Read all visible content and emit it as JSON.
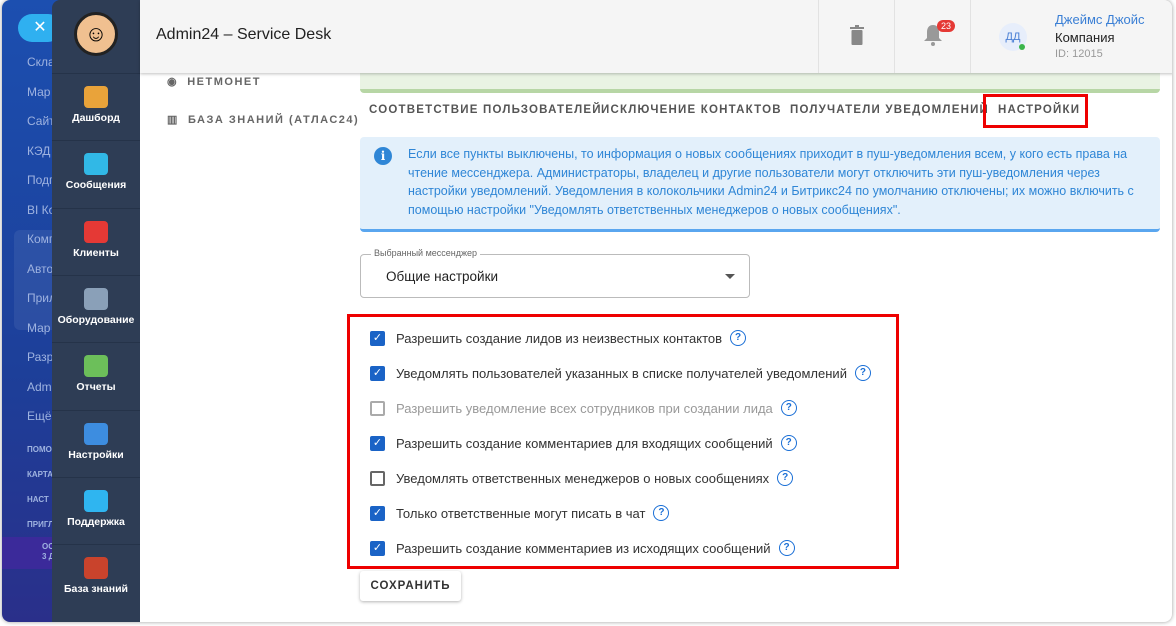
{
  "bitrix_menu": {
    "close": "✕",
    "items": [
      "Скла",
      "Мар",
      "Сайт",
      "КЭД",
      "Подг",
      "BI Ко",
      "Комп",
      "Авто",
      "Прил",
      "Мар",
      "Разр",
      "Adm",
      "Ещё"
    ],
    "small": [
      "ПОМО",
      "КАРТА",
      "НАСТ",
      "ПРИГЛ"
    ],
    "premium": [
      "ОС",
      "3 Д"
    ]
  },
  "app_nav": [
    {
      "label": "Дашборд",
      "icon": "dashboard-icon",
      "color": "#e9a33a"
    },
    {
      "label": "Сообщения",
      "icon": "messages-icon",
      "color": "#31b8e6"
    },
    {
      "label": "Клиенты",
      "icon": "clients-icon",
      "color": "#e53935"
    },
    {
      "label": "Оборудование",
      "icon": "equipment-icon",
      "color": "#8aa0b8"
    },
    {
      "label": "Отчеты",
      "icon": "reports-icon",
      "color": "#6cbf5a"
    },
    {
      "label": "Настройки",
      "icon": "gear-icon",
      "color": "#3d8de0"
    },
    {
      "label": "Поддержка",
      "icon": "help-icon",
      "color": "#2fb5f0"
    },
    {
      "label": "База знаний",
      "icon": "book-icon",
      "color": "#c9432c"
    }
  ],
  "header": {
    "title": "Admin24 – Service Desk",
    "notifications": "23",
    "user_initials": "ДД",
    "user_name": "Джеймс Джойс",
    "company": "Компания",
    "user_id": "ID: 12015"
  },
  "side_links": [
    "НЕТМОНЕТ",
    "БАЗА ЗНАНИЙ (АТЛАС24)"
  ],
  "tabs": [
    "СООТВЕТСТВИЕ ПОЛЬЗОВАТЕЛЕЙ",
    "ИСКЛЮЧЕНИЕ КОНТАКТОВ",
    "ПОЛУЧАТЕЛИ УВЕДОМЛЕНИЙ",
    "НАСТРОЙКИ"
  ],
  "info": "Если все пункты выключены, то информация о новых сообщениях приходит в пуш-уведомления всем, у кого есть права на чтение мессенджера. Администраторы, владелец и другие пользователи могут отключить эти пуш-уведомления через настройки уведомлений. Уведомления в колокольчики Admin24 и Битрикс24 по умолчанию отключены; их можно включить с помощью настройки \"Уведомлять ответственных менеджеров о новых сообщениях\".",
  "messenger_select": {
    "label": "Выбранный мессенджер",
    "value": "Общие настройки"
  },
  "options": [
    {
      "label": "Разрешить создание лидов из неизвестных контактов",
      "checked": true,
      "disabled": false
    },
    {
      "label": "Уведомлять пользователей указанных в списке получателей уведомлений",
      "checked": true,
      "disabled": false
    },
    {
      "label": "Разрешить уведомление всех сотрудников при создании лида",
      "checked": false,
      "disabled": true
    },
    {
      "label": "Разрешить создание комментариев для входящих сообщений",
      "checked": true,
      "disabled": false
    },
    {
      "label": "Уведомлять ответственных менеджеров о новых сообщениях",
      "checked": false,
      "disabled": false
    },
    {
      "label": "Только ответственные могут писать в чат",
      "checked": true,
      "disabled": false
    },
    {
      "label": "Разрешить создание комментариев из исходящих сообщений",
      "checked": true,
      "disabled": false
    }
  ],
  "save_label": "СОХРАНИТЬ"
}
